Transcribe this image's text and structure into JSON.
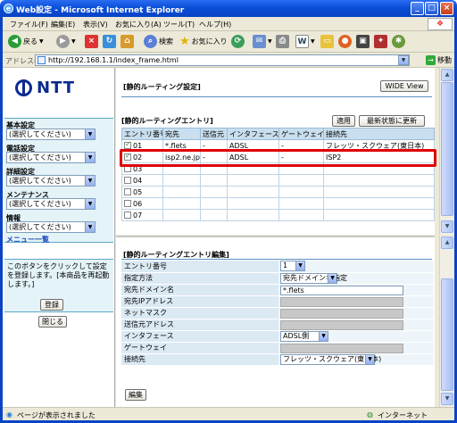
{
  "window": {
    "title": "Web設定 - Microsoft Internet Explorer",
    "app_icon": "ie-icon"
  },
  "menubar": {
    "items": [
      "ファイル(F)",
      "編集(E)",
      "表示(V)",
      "お気に入り(A)",
      "ツール(T)",
      "ヘルプ(H)"
    ]
  },
  "toolbar": {
    "back": "戻る",
    "search": "検索",
    "favorites": "お気に入り",
    "word": "W"
  },
  "address": {
    "label": "アドレス(D)",
    "url": "http://192.168.1.1/index_frame.html",
    "go": "移動"
  },
  "left": {
    "logo": "NTT",
    "nav": [
      {
        "label": "基本設定",
        "value": "(選択してください)"
      },
      {
        "label": "電話設定",
        "value": "(選択してください)"
      },
      {
        "label": "詳細設定",
        "value": "(選択してください)"
      },
      {
        "label": "メンテナンス",
        "value": "(選択してください)"
      },
      {
        "label": "情報",
        "value": "(選択してください)"
      }
    ],
    "menu_list": "メニュー一覧",
    "info_text": "このボタンをクリックして設定を登録します。[本商品を再起動します。]",
    "register": "登録",
    "close": "閉じる"
  },
  "top": {
    "title": "[静的ルーティング設定]",
    "wide_view": "WIDE View",
    "entry_title": "[静的ルーティングエントリ]",
    "apply": "適用",
    "refresh": "最新状態に更新",
    "headers": [
      "エントリ番号",
      "宛先",
      "送信元",
      "インタフェース",
      "ゲートウェイ",
      "接続先"
    ],
    "rows": [
      {
        "no": "01",
        "checked": true,
        "dest": "*.flets",
        "src": "-",
        "iface": "ADSL",
        "gw": "-",
        "conn": "フレッツ・スクウェア(東日本)"
      },
      {
        "no": "02",
        "checked": true,
        "dest": "isp2.ne.jp",
        "src": "-",
        "iface": "ADSL",
        "gw": "-",
        "conn": "ISP2"
      },
      {
        "no": "03",
        "checked": false,
        "dest": "",
        "src": "",
        "iface": "",
        "gw": "",
        "conn": ""
      },
      {
        "no": "04",
        "checked": false,
        "dest": "",
        "src": "",
        "iface": "",
        "gw": "",
        "conn": ""
      },
      {
        "no": "05",
        "checked": false,
        "dest": "",
        "src": "",
        "iface": "",
        "gw": "",
        "conn": ""
      },
      {
        "no": "06",
        "checked": false,
        "dest": "",
        "src": "",
        "iface": "",
        "gw": "",
        "conn": ""
      },
      {
        "no": "07",
        "checked": false,
        "dest": "",
        "src": "",
        "iface": "",
        "gw": "",
        "conn": ""
      }
    ]
  },
  "edit": {
    "title": "[静的ルーティングエントリ編集]",
    "fields": [
      {
        "label": "エントリ番号",
        "type": "select",
        "value": "1"
      },
      {
        "label": "指定方法",
        "type": "select",
        "value": "宛先ドメイン名指定"
      },
      {
        "label": "宛先ドメイン名",
        "type": "input",
        "value": "*.flets"
      },
      {
        "label": "宛先IPアドレス",
        "type": "disabled",
        "value": ""
      },
      {
        "label": "ネットマスク",
        "type": "disabled",
        "value": ""
      },
      {
        "label": "送信元アドレス",
        "type": "disabled",
        "value": ""
      },
      {
        "label": "インタフェース",
        "type": "select",
        "value": "ADSL側"
      },
      {
        "label": "ゲートウェイ",
        "type": "disabled",
        "value": ""
      },
      {
        "label": "接続先",
        "type": "select",
        "value": "フレッツ・スクウェア(東日本)"
      }
    ],
    "edit_button": "編集"
  },
  "status": {
    "text": "ページが表示されました",
    "zone": "インターネット"
  }
}
